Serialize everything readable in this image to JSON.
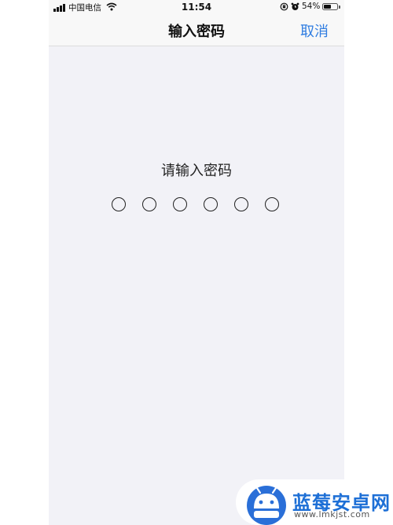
{
  "status_bar": {
    "carrier": "中国电信",
    "time": "11:54",
    "battery_pct_label": "54%",
    "battery_level": 0.54,
    "signal_bars": 4,
    "icons": [
      "signal-icon",
      "wifi-icon",
      "rotation-lock-icon",
      "alarm-icon",
      "battery-icon"
    ]
  },
  "nav": {
    "title": "输入密码",
    "cancel_label": "取消"
  },
  "passcode": {
    "prompt": "请输入密码",
    "length": 6,
    "entered": 0
  },
  "watermark": {
    "name": "蓝莓安卓网",
    "url": "www.lmkjst.com"
  },
  "colors": {
    "accent": "#2f7de1",
    "background": "#f2f2f7",
    "bar": "#f8f8f8",
    "watermark_blue": "#1d6fd6"
  }
}
